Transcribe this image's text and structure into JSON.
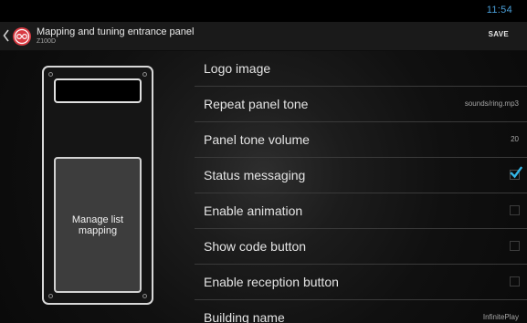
{
  "status_bar": {
    "time": "11:54"
  },
  "action_bar": {
    "title": "Mapping and tuning entrance panel",
    "subtitle": "Z100D",
    "save_label": "SAVE"
  },
  "panel": {
    "manage_button_label": "Manage list mapping"
  },
  "settings": [
    {
      "label": "Logo image",
      "value": null,
      "control": "none"
    },
    {
      "label": "Repeat panel tone",
      "value": "sounds/ring.mp3",
      "control": "value"
    },
    {
      "label": "Panel tone volume",
      "value": "20",
      "control": "value"
    },
    {
      "label": "Status messaging",
      "checked": true,
      "control": "checkbox"
    },
    {
      "label": "Enable animation",
      "checked": false,
      "control": "checkbox"
    },
    {
      "label": "Show code button",
      "checked": false,
      "control": "checkbox"
    },
    {
      "label": "Enable reception button",
      "checked": false,
      "control": "checkbox"
    },
    {
      "label": "Building name",
      "value": "InfinitePlay",
      "control": "value"
    }
  ],
  "colors": {
    "accent": "#33b5e5",
    "status_time": "#4a9fd8",
    "app_icon": "#d93b43",
    "background": "#111111"
  },
  "icons": {
    "up": "chevron-left-icon",
    "app": "app-logo-icon",
    "check": "checkmark-icon"
  }
}
